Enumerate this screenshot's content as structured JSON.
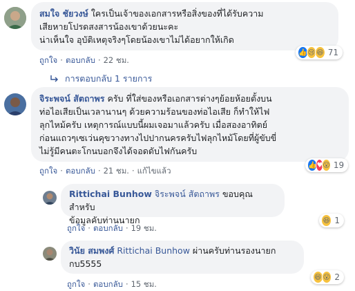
{
  "comments": [
    {
      "author": "สมใจ ชัยวงษ์",
      "lines": [
        "ใครเป็นเจ้าของเอกสารหรือสิ่งของที่ได้รับความ",
        "เสียหายโปรดสงสารน้องเขาด้วยนะคะ",
        "น่าเห็นใจ อุบัติเหตุจริงๆโดยน้องเขาไม่ได้อยากให้เกิด"
      ],
      "like_label": "ถูกใจ",
      "reply_label": "ตอบกลับ",
      "time": "22 ชม.",
      "reaction_icons": [
        "like-icon",
        "sad-icon",
        "haha-icon"
      ],
      "reaction_count": "71",
      "replies_link": "การตอบกลับ 1 รายการ"
    },
    {
      "author": "จิระพจน์ สัตถาพร",
      "lines": [
        "ครับ ที่ใส่ของหรือเอกสารต่างๆย้อยห้อยตั้งบน",
        "ท่อไอเสียเป็นเวลานานๆ ด้วยความร้อนของท่อไอเสีย ก็ทำให้ไฟ",
        "ลุกไหม้ครับ เหตุการณ์แบบนี้ผมเจอมาแล้วครับ เมื่อสองอาทิตย์",
        "ก่อนแถวๆเซเว่นคุขวางทางไปปากนครครับไฟลุกไหม้โดยที่ผู้ขับขี่",
        "ไม่รู้มีคนตะโกนบอกจึงได้จอดดับไฟกันครับ"
      ],
      "like_label": "ถูกใจ",
      "reply_label": "ตอบกลับ",
      "time": "21 ชม.",
      "edited_label": "แก้ไขแล้ว",
      "reaction_icons": [
        "like-icon",
        "love-icon",
        "wow-icon"
      ],
      "reaction_count": "19"
    }
  ],
  "replies": [
    {
      "author": "Rittichai Bunhow",
      "mention": "จิระพจน์ สัตถาพร",
      "lines": [
        "ขอบคุณสำหรับ",
        "ข้อมูลคับท่านนายก"
      ],
      "like_label": "ถูกใจ",
      "reply_label": "ตอบกลับ",
      "time": "19 ชม.",
      "reaction_icons": [
        "haha-icon"
      ],
      "reaction_count": "1"
    },
    {
      "author": "วินัย สมพงศ์",
      "mention": "Rittichai Bunhow",
      "lines": [
        "ผ่านครับท่านรองนายก",
        "กบ5555"
      ],
      "like_label": "ถูกใจ",
      "reply_label": "ตอบกลับ",
      "time": "15 ชม.",
      "reaction_icons": [
        "haha-icon",
        "wow-icon"
      ],
      "reaction_count": "2"
    }
  ],
  "colors": {
    "link": "#385898",
    "bubble": "#f2f3f5",
    "like": "#1877f2",
    "love": "#f33e58",
    "emoji": "#f7c23e"
  }
}
